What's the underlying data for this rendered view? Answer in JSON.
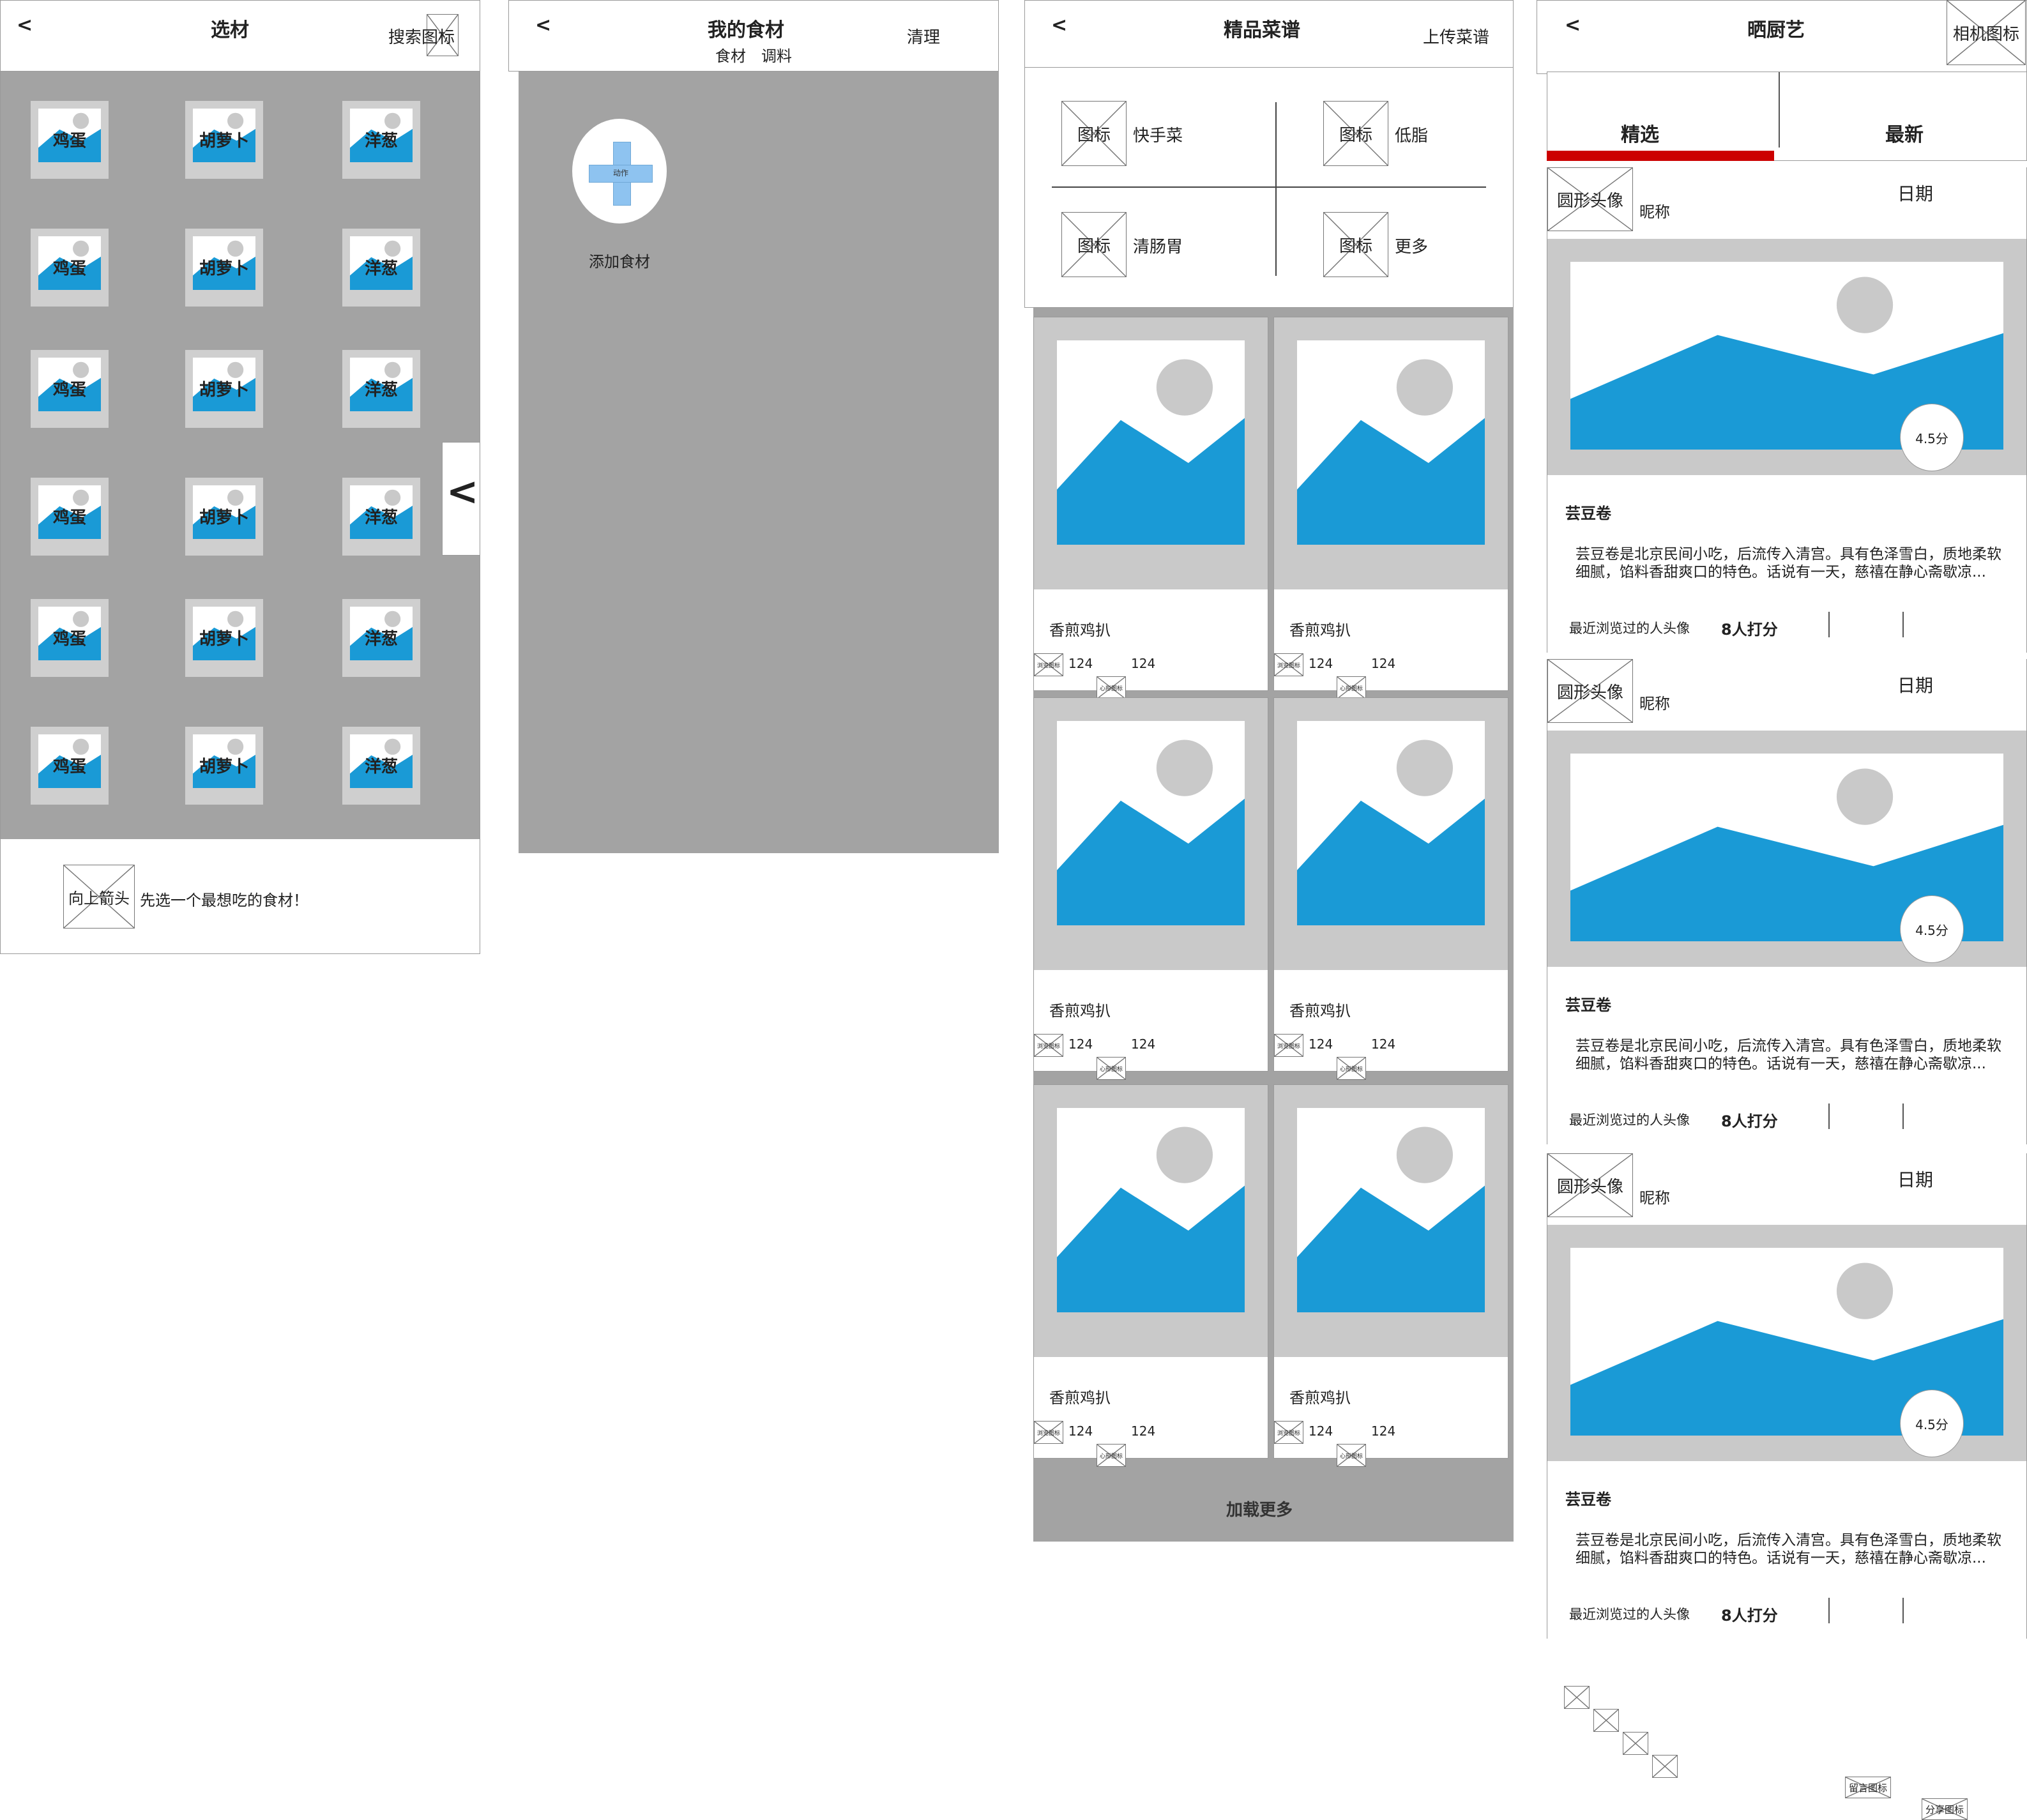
{
  "s1": {
    "back": "<",
    "title": "选材",
    "search_label": "搜索图标",
    "ingredient_cols": [
      "鸡蛋",
      "胡萝卜",
      "洋葱"
    ],
    "side_arrow": "<",
    "bottom_icon": "向上箭头",
    "bottom_tip": "先选一个最想吃的食材！"
  },
  "s2": {
    "back": "<",
    "title": "我的食材",
    "tab1": "食材",
    "tab2": "调料",
    "clear": "清理",
    "add_action": "动作",
    "add_label": "添加食材"
  },
  "s3": {
    "back": "<",
    "title": "精品菜谱",
    "upload": "上传菜谱",
    "categories": [
      {
        "icon": "图标",
        "label": "快手菜"
      },
      {
        "icon": "图标",
        "label": "低脂"
      },
      {
        "icon": "图标",
        "label": "清肠胃"
      },
      {
        "icon": "图标",
        "label": "更多"
      }
    ],
    "card_title": "香煎鸡扒",
    "view_icon": "浏览图标",
    "like_icon": "心形图标",
    "count": "124",
    "load_more": "加载更多"
  },
  "s4": {
    "back": "<",
    "title": "晒厨艺",
    "camera": "相机图标",
    "tab_selected": "精选",
    "tab_latest": "最新",
    "accent": "#cc0000",
    "post": {
      "avatar": "圆形头像",
      "nickname": "昵称",
      "time_icon": "时钟小图标",
      "date": "日期",
      "score": "4.5分",
      "dish": "芸豆卷",
      "desc1": "芸豆卷是北京民间小吃，后流传入清宫。具有色泽雪白，质地柔软",
      "desc2": "细腻，馅料香甜爽口的特色。话说有一天，慈禧在静心斋歇凉...",
      "viewers": "最近浏览过的人头像",
      "raters": "8人打分",
      "comment_icon": "留言图标",
      "share_icon": "分享图标"
    }
  }
}
